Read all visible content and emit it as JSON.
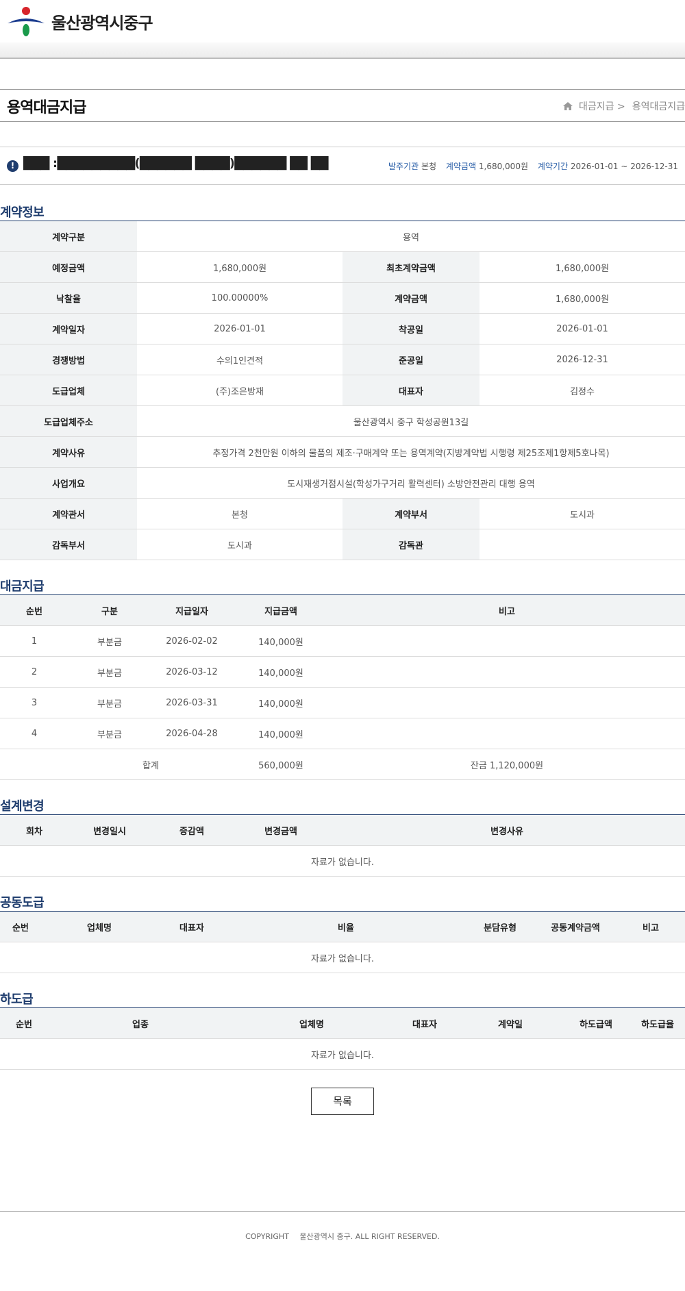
{
  "header": {
    "logo_text": "울산광역시중구"
  },
  "title_bar": {
    "title": "용역대금지급",
    "breadcrumb": [
      "대금지급 >",
      "용역대금지급"
    ]
  },
  "info_bar": {
    "contract_name": "███ :█████████(██████ ████)██████ ██ ██",
    "meta": [
      {
        "label": "발주기관",
        "value": "본청"
      },
      {
        "label": "계약금액",
        "value": "1,680,000원"
      },
      {
        "label": "계약기간",
        "value": "2026-01-01 ~ 2026-12-31"
      }
    ]
  },
  "contract_info": {
    "section_title": "계약정보",
    "type_label": "계약구분",
    "type_value": "용역",
    "est_label": "예정금액",
    "est_value": "1,680,000원",
    "initial_label": "최초계약금액",
    "initial_value": "1,680,000원",
    "rate_label": "낙찰율",
    "rate_value": "100.00000%",
    "amount_label": "계약금액",
    "amount_value": "1,680,000원",
    "date_label": "계약일자",
    "date_value": "2026-01-01",
    "start_label": "착공일",
    "start_value": "2026-01-01",
    "method_label": "경쟁방법",
    "method_value": "수의1인견적",
    "end_label": "준공일",
    "end_value": "2026-12-31",
    "contractor_label": "도급업체",
    "contractor_value": "(주)조은방재",
    "ceo_label": "대표자",
    "ceo_value": "김정수",
    "address_label": "도급업체주소",
    "address_value": "울산광역시 중구 학성공원13길",
    "reason_label": "계약사유",
    "reason_value": "추정가격 2천만원 이하의 물품의 제조·구매계약 또는 용역계약(지방계약법 시행령 제25조제1항제5호나목)",
    "overview_label": "사업개요",
    "overview_value": "도시재생거점시설(학성가구거리 활력센터) 소방안전관리 대행 용역",
    "office_label": "계약관서",
    "office_value": "본청",
    "dept_label": "계약부서",
    "dept_value": "도시과",
    "sup_dept_label": "감독부서",
    "sup_dept_value": "도시과",
    "supervisor_label": "감독관",
    "supervisor_value": ""
  },
  "payment": {
    "section_title": "대금지급",
    "headers": [
      "순번",
      "구분",
      "지급일자",
      "지급금액",
      "비고"
    ],
    "rows": [
      [
        "1",
        "부분금",
        "2026-02-02",
        "140,000원",
        ""
      ],
      [
        "2",
        "부분금",
        "2026-03-12",
        "140,000원",
        ""
      ],
      [
        "3",
        "부분금",
        "2026-03-31",
        "140,000원",
        ""
      ],
      [
        "4",
        "부분금",
        "2026-04-28",
        "140,000원",
        ""
      ]
    ],
    "total_label": "합계",
    "total_value": "560,000원",
    "balance": "잔금 1,120,000원"
  },
  "design_change": {
    "section_title": "설계변경",
    "headers": [
      "회차",
      "변경일시",
      "증감액",
      "변경금액",
      "변경사유"
    ],
    "empty": "자료가 없습니다."
  },
  "joint": {
    "section_title": "공동도급",
    "headers": [
      "순번",
      "업체명",
      "대표자",
      "비율",
      "분담유형",
      "공동계약금액",
      "비고"
    ],
    "empty": "자료가 없습니다."
  },
  "subcontract": {
    "section_title": "하도급",
    "headers": [
      "순번",
      "업종",
      "업체명",
      "대표자",
      "계약일",
      "하도급액",
      "하도급율"
    ],
    "empty": "자료가 없습니다."
  },
  "actions": {
    "list_button": "목록"
  },
  "footer": {
    "copyright": "COPYRIGHT",
    "org": "울산광역시 중구. ALL RIGHT RESERVED."
  },
  "colors": {
    "accent": "#1f3d6e",
    "header_bg": "#f1f3f4",
    "link": "#2a5fa8"
  }
}
